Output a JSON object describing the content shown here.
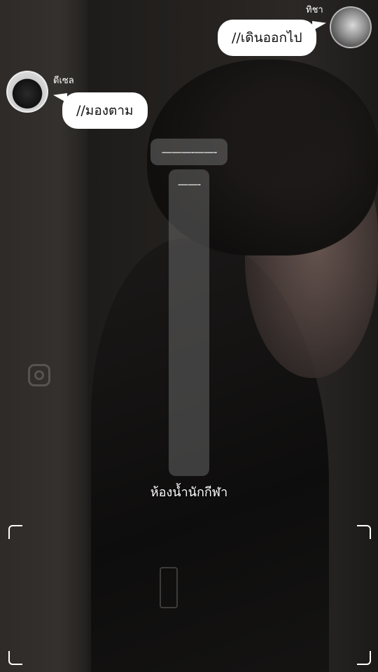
{
  "chat": {
    "messages": [
      {
        "sender": "ทิชา",
        "text": "//เดินออกไป",
        "side": "right"
      },
      {
        "sender": "ดีเซล",
        "text": "//มองตาม",
        "side": "left"
      }
    ]
  },
  "overlay": {
    "top_pill": "———-——-",
    "column_label": "——-",
    "location": "ห้องน้ำนักกีฬา"
  },
  "watermark": {
    "icon": "instagram-icon"
  },
  "colors": {
    "bubble": "#ffffff",
    "overlay": "#6e6e6e",
    "background": "#1a1817"
  }
}
